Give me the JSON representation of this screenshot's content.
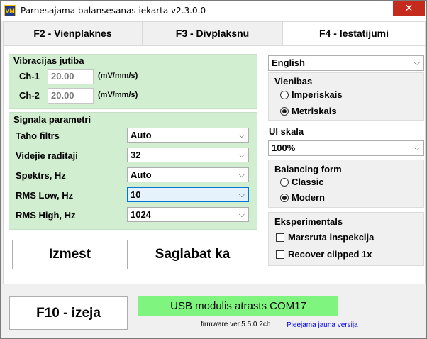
{
  "window": {
    "title": "Parnesajama balansesanas iekarta v2.3.0.0",
    "icon_text": "VM",
    "close_glyph": "✕"
  },
  "tabs": [
    {
      "label": "F2 - Vienplaknes",
      "active": false
    },
    {
      "label": "F3 - Divplaksnu",
      "active": false
    },
    {
      "label": "F4 - Iestatijumi",
      "active": true
    }
  ],
  "sensitivity": {
    "title": "Vibracijas jutiba",
    "channels": [
      {
        "label": "Ch-1",
        "value": "20.00",
        "unit": "(mV/mm/s)"
      },
      {
        "label": "Ch-2",
        "value": "20.00",
        "unit": "(mV/mm/s)"
      }
    ]
  },
  "signal": {
    "title": "Signala parametri",
    "rows": [
      {
        "label": "Taho filtrs",
        "value": "Auto"
      },
      {
        "label": "Videjie raditaji",
        "value": "32"
      },
      {
        "label": "Spektrs, Hz",
        "value": "Auto"
      },
      {
        "label": "RMS Low, Hz",
        "value": "10"
      },
      {
        "label": "RMS High, Hz",
        "value": "1024"
      }
    ]
  },
  "actions": {
    "reset_label": "Izmest",
    "save_label": "Saglabat ka"
  },
  "language": {
    "value": "English"
  },
  "units": {
    "title": "Vienibas",
    "options": [
      {
        "label": "Imperiskais",
        "selected": false
      },
      {
        "label": "Metriskais",
        "selected": true
      }
    ]
  },
  "ui_scale": {
    "title": "UI skala",
    "value": "100%"
  },
  "balancing_form": {
    "title": "Balancing form",
    "options": [
      {
        "label": "Classic",
        "selected": false
      },
      {
        "label": "Modern",
        "selected": true
      }
    ]
  },
  "experimental": {
    "title": "Eksperimentals",
    "checks": [
      {
        "label": "Marsruta inspekcija",
        "checked": false
      },
      {
        "label": "Recover clipped 1x",
        "checked": false
      }
    ]
  },
  "footer": {
    "exit_label": "F10 - izeja",
    "usb_status": "USB modulis atrasts COM17",
    "usb_status_color": "#7ff57f",
    "firmware": "firmware ver.5.5.0 2ch",
    "new_version_link": "Pieejama jauna versija"
  },
  "icons": {
    "dropdown": "chevron-down-icon"
  }
}
